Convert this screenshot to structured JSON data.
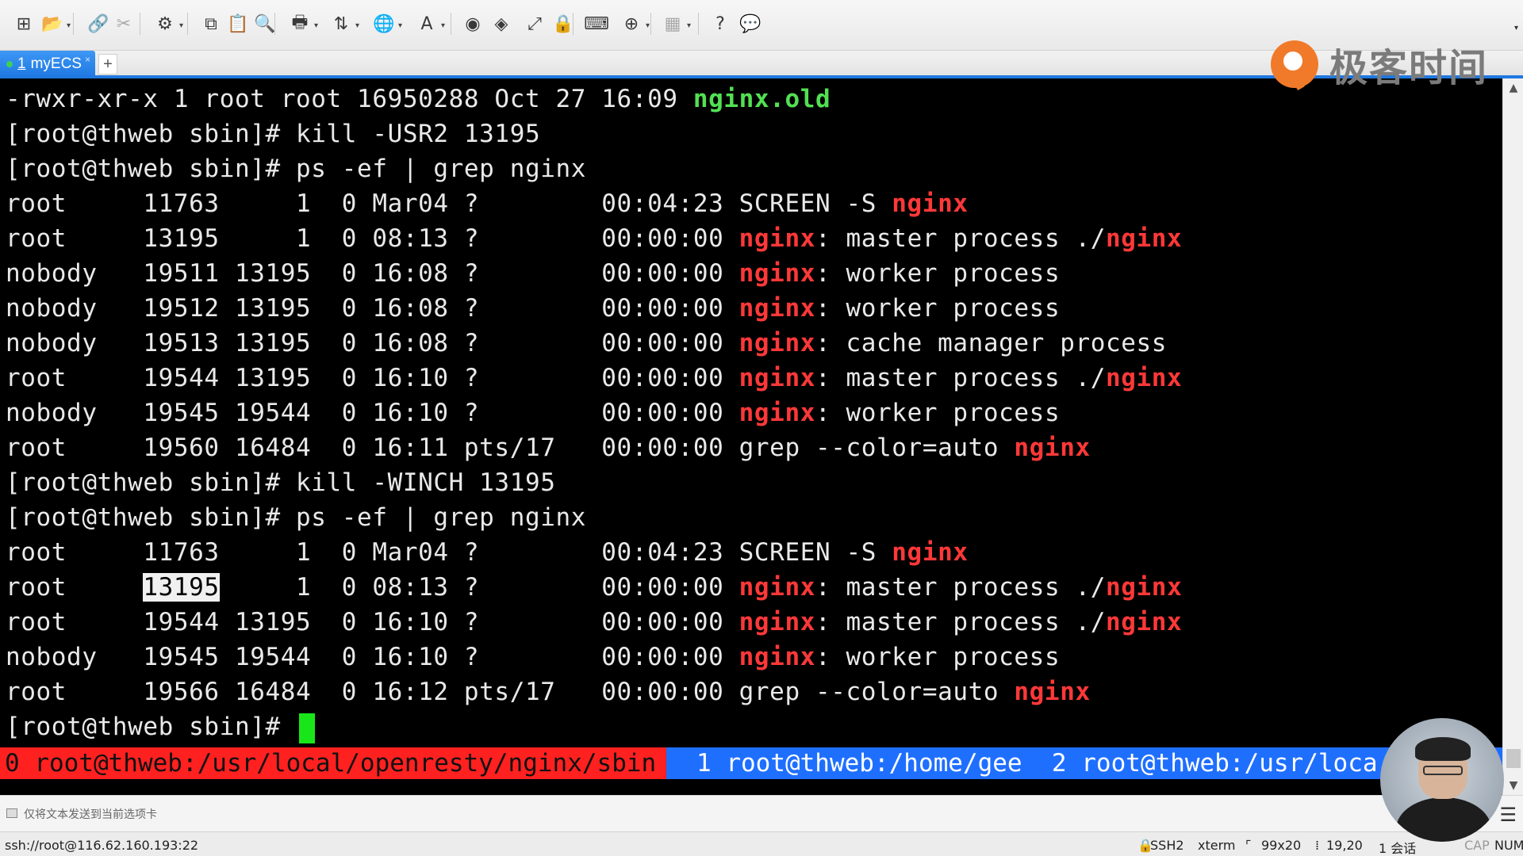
{
  "app": {
    "name": "Xshell",
    "accent_color": "#1f78e0"
  },
  "toolbar": {
    "buttons": [
      {
        "icon": "new-session-icon",
        "glyph": "⊞"
      },
      {
        "icon": "open-folder-icon",
        "glyph": "📂"
      },
      {
        "icon": "reconnect-icon",
        "glyph": "🔗"
      },
      {
        "icon": "disconnect-icon",
        "glyph": "✂"
      },
      {
        "icon": "properties-icon",
        "glyph": "⚙"
      },
      {
        "icon": "copy-icon",
        "glyph": "⧉"
      },
      {
        "icon": "paste-icon",
        "glyph": "📋"
      },
      {
        "icon": "find-icon",
        "glyph": "🔍"
      },
      {
        "icon": "print-icon",
        "glyph": "🖶"
      },
      {
        "icon": "transfer-icon",
        "glyph": "⇅"
      },
      {
        "icon": "globe-icon",
        "glyph": "🌐"
      },
      {
        "icon": "font-icon",
        "glyph": "A"
      },
      {
        "icon": "xftp-icon",
        "glyph": "◉"
      },
      {
        "icon": "xagent-icon",
        "glyph": "◈"
      },
      {
        "icon": "fullscreen-icon",
        "glyph": "⤢"
      },
      {
        "icon": "lock-icon",
        "glyph": "🔒"
      },
      {
        "icon": "keyboard-icon",
        "glyph": "⌨"
      },
      {
        "icon": "add-icon",
        "glyph": "⊕"
      },
      {
        "icon": "layout-icon",
        "glyph": "▦"
      },
      {
        "icon": "help-icon",
        "glyph": "?"
      },
      {
        "icon": "chat-icon",
        "glyph": "💬"
      }
    ]
  },
  "tabs": [
    {
      "number": "1",
      "label": "myECS",
      "active": true,
      "close": "×"
    }
  ],
  "tab_add_label": "+",
  "logo": {
    "text": "极客时间",
    "color": "#f07a2a"
  },
  "terminal": {
    "lines": [
      {
        "segments": [
          {
            "text": "-rwxr-xr-x 1 root root 16950288 Oct 27 16:09 ",
            "style": ""
          },
          {
            "text": "nginx.old",
            "style": "green"
          }
        ]
      },
      {
        "segments": [
          {
            "text": "[root@thweb sbin]# kill -USR2 13195",
            "style": ""
          }
        ]
      },
      {
        "segments": [
          {
            "text": "[root@thweb sbin]# ps -ef | grep nginx",
            "style": ""
          }
        ]
      },
      {
        "segments": [
          {
            "text": "root     11763     1  0 Mar04 ?        00:04:23 SCREEN -S ",
            "style": ""
          },
          {
            "text": "nginx",
            "style": "red"
          }
        ]
      },
      {
        "segments": [
          {
            "text": "root     13195     1  0 08:13 ?        00:00:00 ",
            "style": ""
          },
          {
            "text": "nginx",
            "style": "red"
          },
          {
            "text": ": master process ./",
            "style": ""
          },
          {
            "text": "nginx",
            "style": "red"
          }
        ]
      },
      {
        "segments": [
          {
            "text": "nobody   19511 13195  0 16:08 ?        00:00:00 ",
            "style": ""
          },
          {
            "text": "nginx",
            "style": "red"
          },
          {
            "text": ": worker process",
            "style": ""
          }
        ]
      },
      {
        "segments": [
          {
            "text": "nobody   19512 13195  0 16:08 ?        00:00:00 ",
            "style": ""
          },
          {
            "text": "nginx",
            "style": "red"
          },
          {
            "text": ": worker process",
            "style": ""
          }
        ]
      },
      {
        "segments": [
          {
            "text": "nobody   19513 13195  0 16:08 ?        00:00:00 ",
            "style": ""
          },
          {
            "text": "nginx",
            "style": "red"
          },
          {
            "text": ": cache manager process",
            "style": ""
          }
        ]
      },
      {
        "segments": [
          {
            "text": "root     19544 13195  0 16:10 ?        00:00:00 ",
            "style": ""
          },
          {
            "text": "nginx",
            "style": "red"
          },
          {
            "text": ": master process ./",
            "style": ""
          },
          {
            "text": "nginx",
            "style": "red"
          }
        ]
      },
      {
        "segments": [
          {
            "text": "nobody   19545 19544  0 16:10 ?        00:00:00 ",
            "style": ""
          },
          {
            "text": "nginx",
            "style": "red"
          },
          {
            "text": ": worker process",
            "style": ""
          }
        ]
      },
      {
        "segments": [
          {
            "text": "root     19560 16484  0 16:11 pts/17   00:00:00 grep --color=auto ",
            "style": ""
          },
          {
            "text": "nginx",
            "style": "red"
          }
        ]
      },
      {
        "segments": [
          {
            "text": "[root@thweb sbin]# kill -WINCH 13195",
            "style": ""
          }
        ]
      },
      {
        "segments": [
          {
            "text": "[root@thweb sbin]# ps -ef | grep nginx",
            "style": ""
          }
        ]
      },
      {
        "segments": [
          {
            "text": "root     11763     1  0 Mar04 ?        00:04:23 SCREEN -S ",
            "style": ""
          },
          {
            "text": "nginx",
            "style": "red"
          }
        ]
      },
      {
        "segments": [
          {
            "text": "root     ",
            "style": ""
          },
          {
            "text": "13195",
            "style": "highlight"
          },
          {
            "text": "     1  0 08:13 ?        00:00:00 ",
            "style": ""
          },
          {
            "text": "nginx",
            "style": "red"
          },
          {
            "text": ": master process ./",
            "style": ""
          },
          {
            "text": "nginx",
            "style": "red"
          }
        ]
      },
      {
        "segments": [
          {
            "text": "root     19544 13195  0 16:10 ?        00:00:00 ",
            "style": ""
          },
          {
            "text": "nginx",
            "style": "red"
          },
          {
            "text": ": master process ./",
            "style": ""
          },
          {
            "text": "nginx",
            "style": "red"
          }
        ]
      },
      {
        "segments": [
          {
            "text": "nobody   19545 19544  0 16:10 ?        00:00:00 ",
            "style": ""
          },
          {
            "text": "nginx",
            "style": "red"
          },
          {
            "text": ": worker process",
            "style": ""
          }
        ]
      },
      {
        "segments": [
          {
            "text": "root     19566 16484  0 16:12 pts/17   00:00:00 grep --color=auto ",
            "style": ""
          },
          {
            "text": "nginx",
            "style": "red"
          }
        ]
      },
      {
        "segments": [
          {
            "text": "[root@thweb sbin]# ",
            "style": ""
          }
        ],
        "cursor": true
      }
    ],
    "colors": {
      "text": "#e9e9e9",
      "green": "#52e052",
      "red": "#ff3838",
      "cursor": "#19e619"
    }
  },
  "screen_status": {
    "active_window": "0 root@thweb:/usr/local/openresty/nginx/sbin",
    "other_windows": "1 root@thweb:/home/gee  2 root@thweb:/usr/loca",
    "active_color": "#ff2020",
    "other_color": "#1f6fff"
  },
  "compose_bar": {
    "text": "仅将文本发送到当前选项卡",
    "menu_icon": "☰"
  },
  "statusbar": {
    "connection": "ssh://root@116.62.160.193:22",
    "protocol": "SSH2",
    "terminal_type": "xterm",
    "size": "99x20",
    "cursor_pos": "19,20",
    "sessions": "1 会话",
    "caps": "CAP",
    "num": "NUM"
  }
}
